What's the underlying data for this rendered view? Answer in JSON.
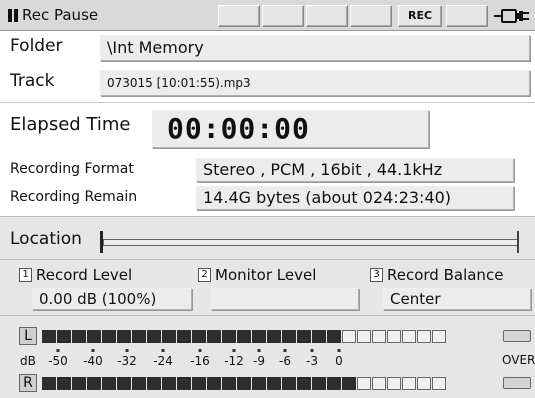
{
  "status": {
    "state_text": "Rec Pause",
    "rec_badge": "REC",
    "state_icon": "pause-icon",
    "power_icon": "battery-plug-icon"
  },
  "info": {
    "folder_label": "Folder",
    "folder_value": "\\Int Memory",
    "track_label": "Track",
    "track_value": "073015 [10:01:55).mp3"
  },
  "elapsed": {
    "label": "Elapsed Time",
    "value": "00:00:00"
  },
  "recording": {
    "format_label": "Recording Format",
    "format_value": "Stereo , PCM , 16bit , 44.1kHz",
    "remain_label": "Recording Remain",
    "remain_value": "14.4G bytes (about 024:23:40)"
  },
  "location": {
    "label": "Location",
    "position": 0.0
  },
  "levels": {
    "record": {
      "num": "1",
      "label": "Record Level",
      "value": "0.00 dB (100%)"
    },
    "monitor": {
      "num": "2",
      "label": "Monitor Level",
      "value": ""
    },
    "balance": {
      "num": "3",
      "label": "Record Balance",
      "value": "Center"
    }
  },
  "meters": {
    "left_label": "L",
    "right_label": "R",
    "unit_label": "dB",
    "over_label": "OVER",
    "scale": [
      "-50",
      "-40",
      "-32",
      "-24",
      "-16",
      "-12",
      "-9",
      "-6",
      "-3",
      "0"
    ],
    "segments": 27,
    "left_lit": 20,
    "right_lit": 21
  },
  "colors": {
    "status_bg": "#d9d9d9",
    "panel_bg": "#e6e6e6",
    "field_bg": "#ececec",
    "meter_on": "#2d2d2d"
  }
}
